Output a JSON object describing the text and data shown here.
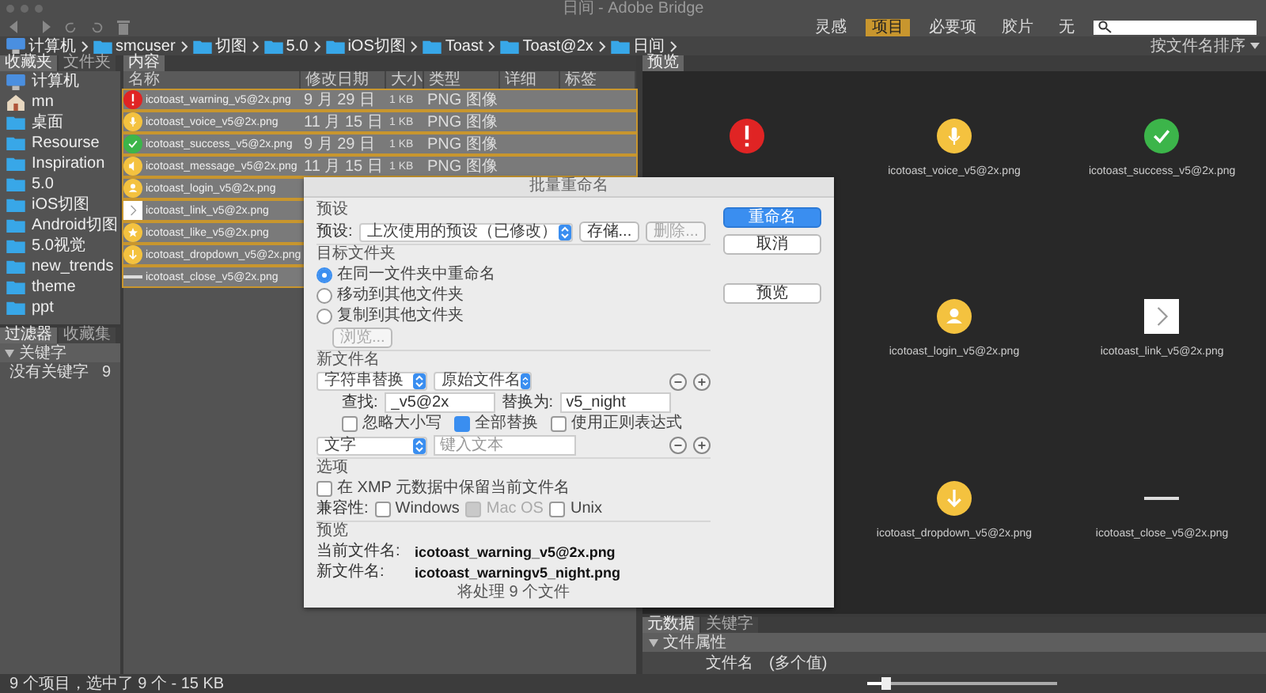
{
  "window": {
    "title": "日间 - Adobe Bridge"
  },
  "workspaces": [
    {
      "label": "灵感",
      "selected": false
    },
    {
      "label": "项目",
      "selected": true
    },
    {
      "label": "必要项",
      "selected": false
    },
    {
      "label": "胶片",
      "selected": false
    },
    {
      "label": "无",
      "selected": false
    }
  ],
  "breadcrumb": [
    {
      "label": "计算机",
      "kind": "computer"
    },
    {
      "label": "smcuser",
      "kind": "folder"
    },
    {
      "label": "切图",
      "kind": "folder"
    },
    {
      "label": "5.0",
      "kind": "folder"
    },
    {
      "label": "iOS切图",
      "kind": "folder"
    },
    {
      "label": "Toast",
      "kind": "folder"
    },
    {
      "label": "Toast@2x",
      "kind": "folder"
    },
    {
      "label": "日间",
      "kind": "folder"
    }
  ],
  "sort": {
    "label": "按文件名排序"
  },
  "left_tabs": [
    {
      "label": "收藏夹",
      "selected": true
    },
    {
      "label": "文件夹",
      "selected": false
    }
  ],
  "favorites": [
    {
      "label": "计算机",
      "kind": "computer"
    },
    {
      "label": "mn",
      "kind": "home"
    },
    {
      "label": "桌面",
      "kind": "folder"
    },
    {
      "label": "Resourse",
      "kind": "folder"
    },
    {
      "label": "Inspiration",
      "kind": "folder"
    },
    {
      "label": "5.0",
      "kind": "folder"
    },
    {
      "label": "iOS切图",
      "kind": "folder"
    },
    {
      "label": "Android切图",
      "kind": "folder"
    },
    {
      "label": "5.0视觉",
      "kind": "folder"
    },
    {
      "label": "new_trends",
      "kind": "folder"
    },
    {
      "label": "theme",
      "kind": "folder"
    },
    {
      "label": "ppt",
      "kind": "folder"
    }
  ],
  "filter_tabs": [
    {
      "label": "过滤器",
      "selected": true
    },
    {
      "label": "收藏集",
      "selected": false
    }
  ],
  "filter": {
    "heading": "关键字",
    "items": [
      {
        "label": "没有关键字",
        "count": "9"
      }
    ]
  },
  "content_tab": {
    "label": "内容"
  },
  "columns": [
    "名称",
    "修改日期",
    "大小",
    "类型",
    "详细",
    "标签"
  ],
  "files": [
    {
      "name": "icotoast_warning_v5@2x.png",
      "date": "9 月 29 日",
      "size": "1 KB",
      "type": "PNG 图像",
      "kind": "warning",
      "selected": true
    },
    {
      "name": "icotoast_voice_v5@2x.png",
      "date": "11 月 15 日",
      "size": "1 KB",
      "type": "PNG 图像",
      "kind": "voice",
      "selected": true
    },
    {
      "name": "icotoast_success_v5@2x.png",
      "date": "9 月 29 日",
      "size": "1 KB",
      "type": "PNG 图像",
      "kind": "success",
      "selected": true
    },
    {
      "name": "icotoast_message_v5@2x.png",
      "date": "11 月 15 日",
      "size": "1 KB",
      "type": "PNG 图像",
      "kind": "message",
      "selected": true
    },
    {
      "name": "icotoast_login_v5@2x.png",
      "kind": "login",
      "selected": true
    },
    {
      "name": "icotoast_link_v5@2x.png",
      "kind": "link",
      "selected": true
    },
    {
      "name": "icotoast_like_v5@2x.png",
      "kind": "like",
      "selected": true
    },
    {
      "name": "icotoast_dropdown_v5@2x.png",
      "kind": "dropdown",
      "selected": true
    },
    {
      "name": "icotoast_close_v5@2x.png",
      "kind": "close",
      "selected": true
    }
  ],
  "preview_tab": {
    "label": "预览"
  },
  "thumbnails": [
    {
      "kind": "warning"
    },
    {
      "kind": "voice",
      "caption": "icotoast_voice_v5@2x.png"
    },
    {
      "kind": "success",
      "caption": "icotoast_success_v5@2x.png"
    },
    {
      "kind": "login",
      "caption": "icotoast_login_v5@2x.png"
    },
    {
      "kind": "link",
      "caption": "icotoast_link_v5@2x.png"
    },
    {
      "kind": "dropdown",
      "caption": "icotoast_dropdown_v5@2x.png"
    },
    {
      "kind": "close",
      "caption": "icotoast_close_v5@2x.png"
    }
  ],
  "metadata": {
    "tabs": [
      {
        "label": "元数据",
        "selected": true
      },
      {
        "label": "关键字",
        "selected": false
      }
    ],
    "section": "文件属性",
    "rows": [
      {
        "label": "文件名",
        "value": "(多个值)"
      }
    ]
  },
  "status_bar": {
    "text": "9 个项目，选中了 9 个 - 15 KB",
    "zoom": {
      "level": 0.1
    }
  },
  "dialog": {
    "title": "批量重命名",
    "preset_heading": "预设",
    "preset_label": "预设:",
    "preset_value": "上次使用的预设（已修改）",
    "save_button": "存储...",
    "delete_button": {
      "label": "删除...",
      "disabled": true
    },
    "actions": [
      {
        "label": "重命名",
        "primary": true
      },
      {
        "label": "取消",
        "primary": false
      },
      {
        "label": "预览",
        "primary": false
      }
    ],
    "dest_heading": "目标文件夹",
    "dest_options": [
      {
        "label": "在同一文件夹中重命名",
        "selected": true
      },
      {
        "label": "移动到其他文件夹",
        "selected": false
      },
      {
        "label": "复制到其他文件夹",
        "selected": false
      }
    ],
    "browse": {
      "label": "浏览...",
      "disabled": true
    },
    "name_heading": "新文件名",
    "rules": [
      {
        "kind": "replace",
        "type": "字符串替换",
        "source": "原始文件名",
        "find_label": "查找:",
        "find": "_v5@2x",
        "replace_label": "替换为:",
        "replace": "v5_night",
        "options": [
          {
            "label": "忽略大小写",
            "checked": false
          },
          {
            "label": "全部替换",
            "checked": true
          },
          {
            "label": "使用正则表达式",
            "checked": false
          }
        ]
      },
      {
        "kind": "text",
        "type": "文字",
        "placeholder": "键入文本"
      }
    ],
    "options_heading": "选项",
    "keep_xmp": {
      "label": "在 XMP 元数据中保留当前文件名",
      "checked": false
    },
    "compat_label": "兼容性:",
    "compat": [
      {
        "label": "Windows",
        "checked": false,
        "disabled": false
      },
      {
        "label": "Mac OS",
        "checked": true,
        "disabled": true
      },
      {
        "label": "Unix",
        "checked": false,
        "disabled": false
      }
    ],
    "preview_heading": "预览",
    "current_label": "当前文件名:",
    "current": "icotoast_warning_v5@2x.png",
    "new_label": "新文件名:",
    "new": "icotoast_warningv5_night.png",
    "count": "将处理 9 个文件"
  }
}
